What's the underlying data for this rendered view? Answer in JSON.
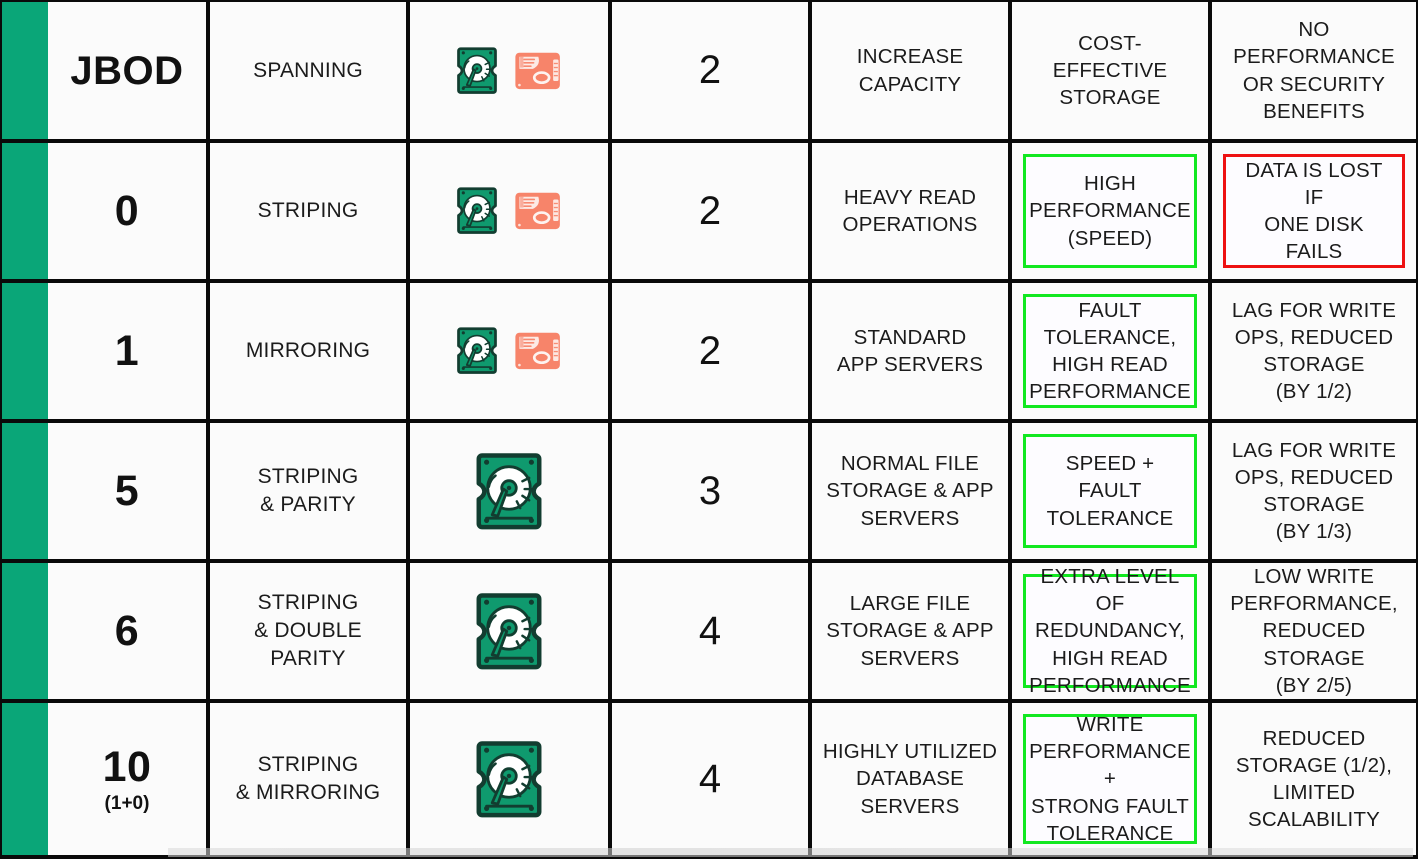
{
  "table": {
    "accent_color": "#0aa678",
    "highlight_good_color": "#12e820",
    "highlight_bad_color": "#ee1111",
    "disk_icon_green": "#0f9a6e",
    "disk_icon_salmon": "#f7846a",
    "rows": [
      {
        "level": "JBOD",
        "level_sub": "",
        "technique": "SPANNING",
        "disks_icon": "two-disks-small",
        "min_disks": "2",
        "use_case": "INCREASE\nCAPACITY",
        "advantage": "COST-\nEFFECTIVE\nSTORAGE",
        "advantage_highlight": "none",
        "disadvantage": "NO\nPERFORMANCE\nOR SECURITY\nBENEFITS",
        "disadvantage_highlight": "none"
      },
      {
        "level": "0",
        "level_sub": "",
        "technique": "STRIPING",
        "disks_icon": "two-disks-small",
        "min_disks": "2",
        "use_case": "HEAVY READ\nOPERATIONS",
        "advantage": "HIGH\nPERFORMANCE\n(SPEED)",
        "advantage_highlight": "green",
        "disadvantage": "DATA IS LOST IF\nONE DISK FAILS",
        "disadvantage_highlight": "red"
      },
      {
        "level": "1",
        "level_sub": "",
        "technique": "MIRRORING",
        "disks_icon": "two-disks-small",
        "min_disks": "2",
        "use_case": "STANDARD\nAPP SERVERS",
        "advantage": "FAULT\nTOLERANCE,\nHIGH READ\nPERFORMANCE",
        "advantage_highlight": "green",
        "disadvantage": "LAG FOR WRITE\nOPS, REDUCED\nSTORAGE\n(BY 1/2)",
        "disadvantage_highlight": "none"
      },
      {
        "level": "5",
        "level_sub": "",
        "technique": "STRIPING\n& PARITY",
        "disks_icon": "one-disk-large",
        "min_disks": "3",
        "use_case": "NORMAL FILE\nSTORAGE & APP\nSERVERS",
        "advantage": "SPEED + FAULT\nTOLERANCE",
        "advantage_highlight": "green",
        "disadvantage": "LAG FOR WRITE\nOPS, REDUCED\nSTORAGE\n(BY 1/3)",
        "disadvantage_highlight": "none"
      },
      {
        "level": "6",
        "level_sub": "",
        "technique": "STRIPING\n& DOUBLE\nPARITY",
        "disks_icon": "one-disk-large",
        "min_disks": "4",
        "use_case": "LARGE FILE\nSTORAGE & APP\nSERVERS",
        "advantage": "EXTRA LEVEL OF\nREDUNDANCY,\nHIGH READ\nPERFORMANCE",
        "advantage_highlight": "green",
        "disadvantage": "LOW WRITE\nPERFORMANCE,\nREDUCED\nSTORAGE\n(BY 2/5)",
        "disadvantage_highlight": "none"
      },
      {
        "level": "10",
        "level_sub": "(1+0)",
        "technique": "STRIPING\n& MIRRORING",
        "disks_icon": "one-disk-large",
        "min_disks": "4",
        "use_case": "HIGHLY UTILIZED\nDATABASE\nSERVERS",
        "advantage": "WRITE\nPERFORMANCE +\nSTRONG FAULT\nTOLERANCE",
        "advantage_highlight": "green",
        "disadvantage": "REDUCED\nSTORAGE (1/2),\nLIMITED\nSCALABILITY",
        "disadvantage_highlight": "none"
      }
    ]
  }
}
